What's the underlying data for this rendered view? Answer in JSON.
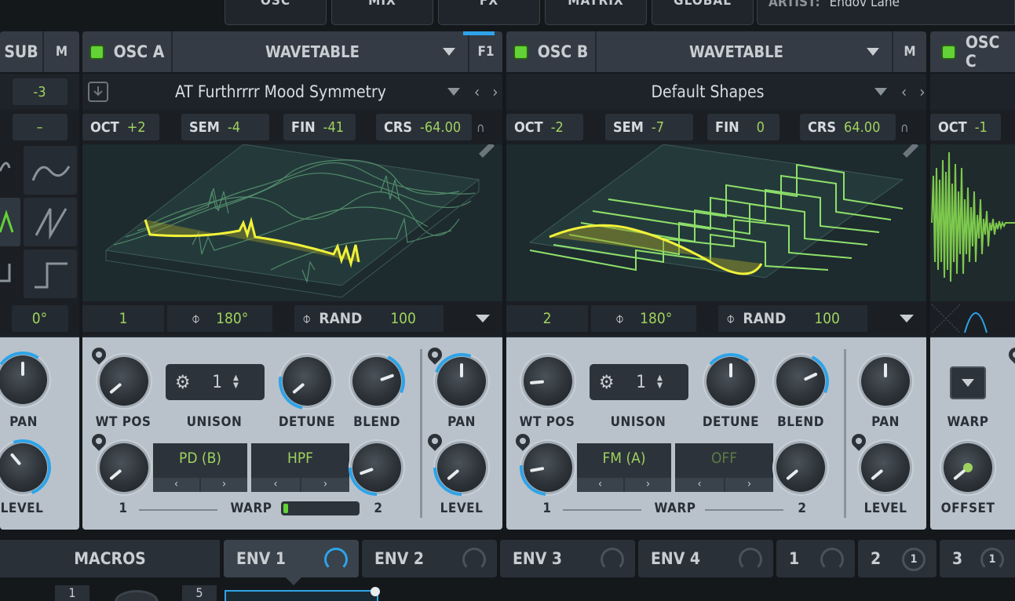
{
  "top_tabs": [
    "OSC",
    "MIX",
    "FX",
    "MATRIX",
    "GLOBAL"
  ],
  "artist": {
    "label": "ARTIST:",
    "value": "Endov Lane"
  },
  "sub": {
    "title": "SUB",
    "mode": "M",
    "octave": "-3",
    "dash": "–",
    "phase": "0°",
    "pan_label": "PAN",
    "level_label": "LEVEL"
  },
  "osc_a": {
    "title": "OSC A",
    "type": "WAVETABLE",
    "flag": "F1",
    "preset": "AT Furthrrrr Mood Symmetry",
    "oct_label": "OCT",
    "oct": "+2",
    "sem_label": "SEM",
    "sem": "-4",
    "fin_label": "FIN",
    "fin": "-41",
    "crs_label": "CRS",
    "crs": "-64.00",
    "frame": "1",
    "phase": "180°",
    "rand_label": "RAND",
    "rand": "100",
    "wt_pos_label": "WT POS",
    "unison_label": "UNISON",
    "unison_value": "1",
    "detune_label": "DETUNE",
    "blend_label": "BLEND",
    "warp1": "PD (B)",
    "warp2": "HPF",
    "warp_label": "WARP",
    "warp_num1": "1",
    "warp_num2": "2",
    "pan_label": "PAN",
    "level_label": "LEVEL"
  },
  "osc_b": {
    "title": "OSC B",
    "type": "WAVETABLE",
    "mode": "M",
    "preset": "Default Shapes",
    "oct_label": "OCT",
    "oct": "-2",
    "sem_label": "SEM",
    "sem": "-7",
    "fin_label": "FIN",
    "fin": "0",
    "crs_label": "CRS",
    "crs": "64.00",
    "frame": "2",
    "phase": "180°",
    "rand_label": "RAND",
    "rand": "100",
    "wt_pos_label": "WT POS",
    "unison_label": "UNISON",
    "unison_value": "1",
    "detune_label": "DETUNE",
    "blend_label": "BLEND",
    "warp1": "FM (A)",
    "warp2": "OFF",
    "warp_label": "WARP",
    "warp_num1": "1",
    "warp_num2": "2",
    "pan_label": "PAN",
    "level_label": "LEVEL"
  },
  "osc_c": {
    "title": "OSC C",
    "oct_label": "OCT",
    "oct": "-1",
    "warp_label": "WARP",
    "offset_label": "OFFSET"
  },
  "bottom": {
    "macros": "MACROS",
    "tabs": [
      "ENV 1",
      "ENV 2",
      "ENV 3",
      "ENV 4",
      "1",
      "2",
      "3"
    ],
    "lfo_badges": [
      "1",
      "1"
    ],
    "macro_nums": [
      "1",
      "5"
    ]
  },
  "colors": {
    "accent_green": "#9ed25e",
    "led_green": "#62d236",
    "mod_blue": "#2ea3e8",
    "wave_yellow": "#f2f23a"
  }
}
